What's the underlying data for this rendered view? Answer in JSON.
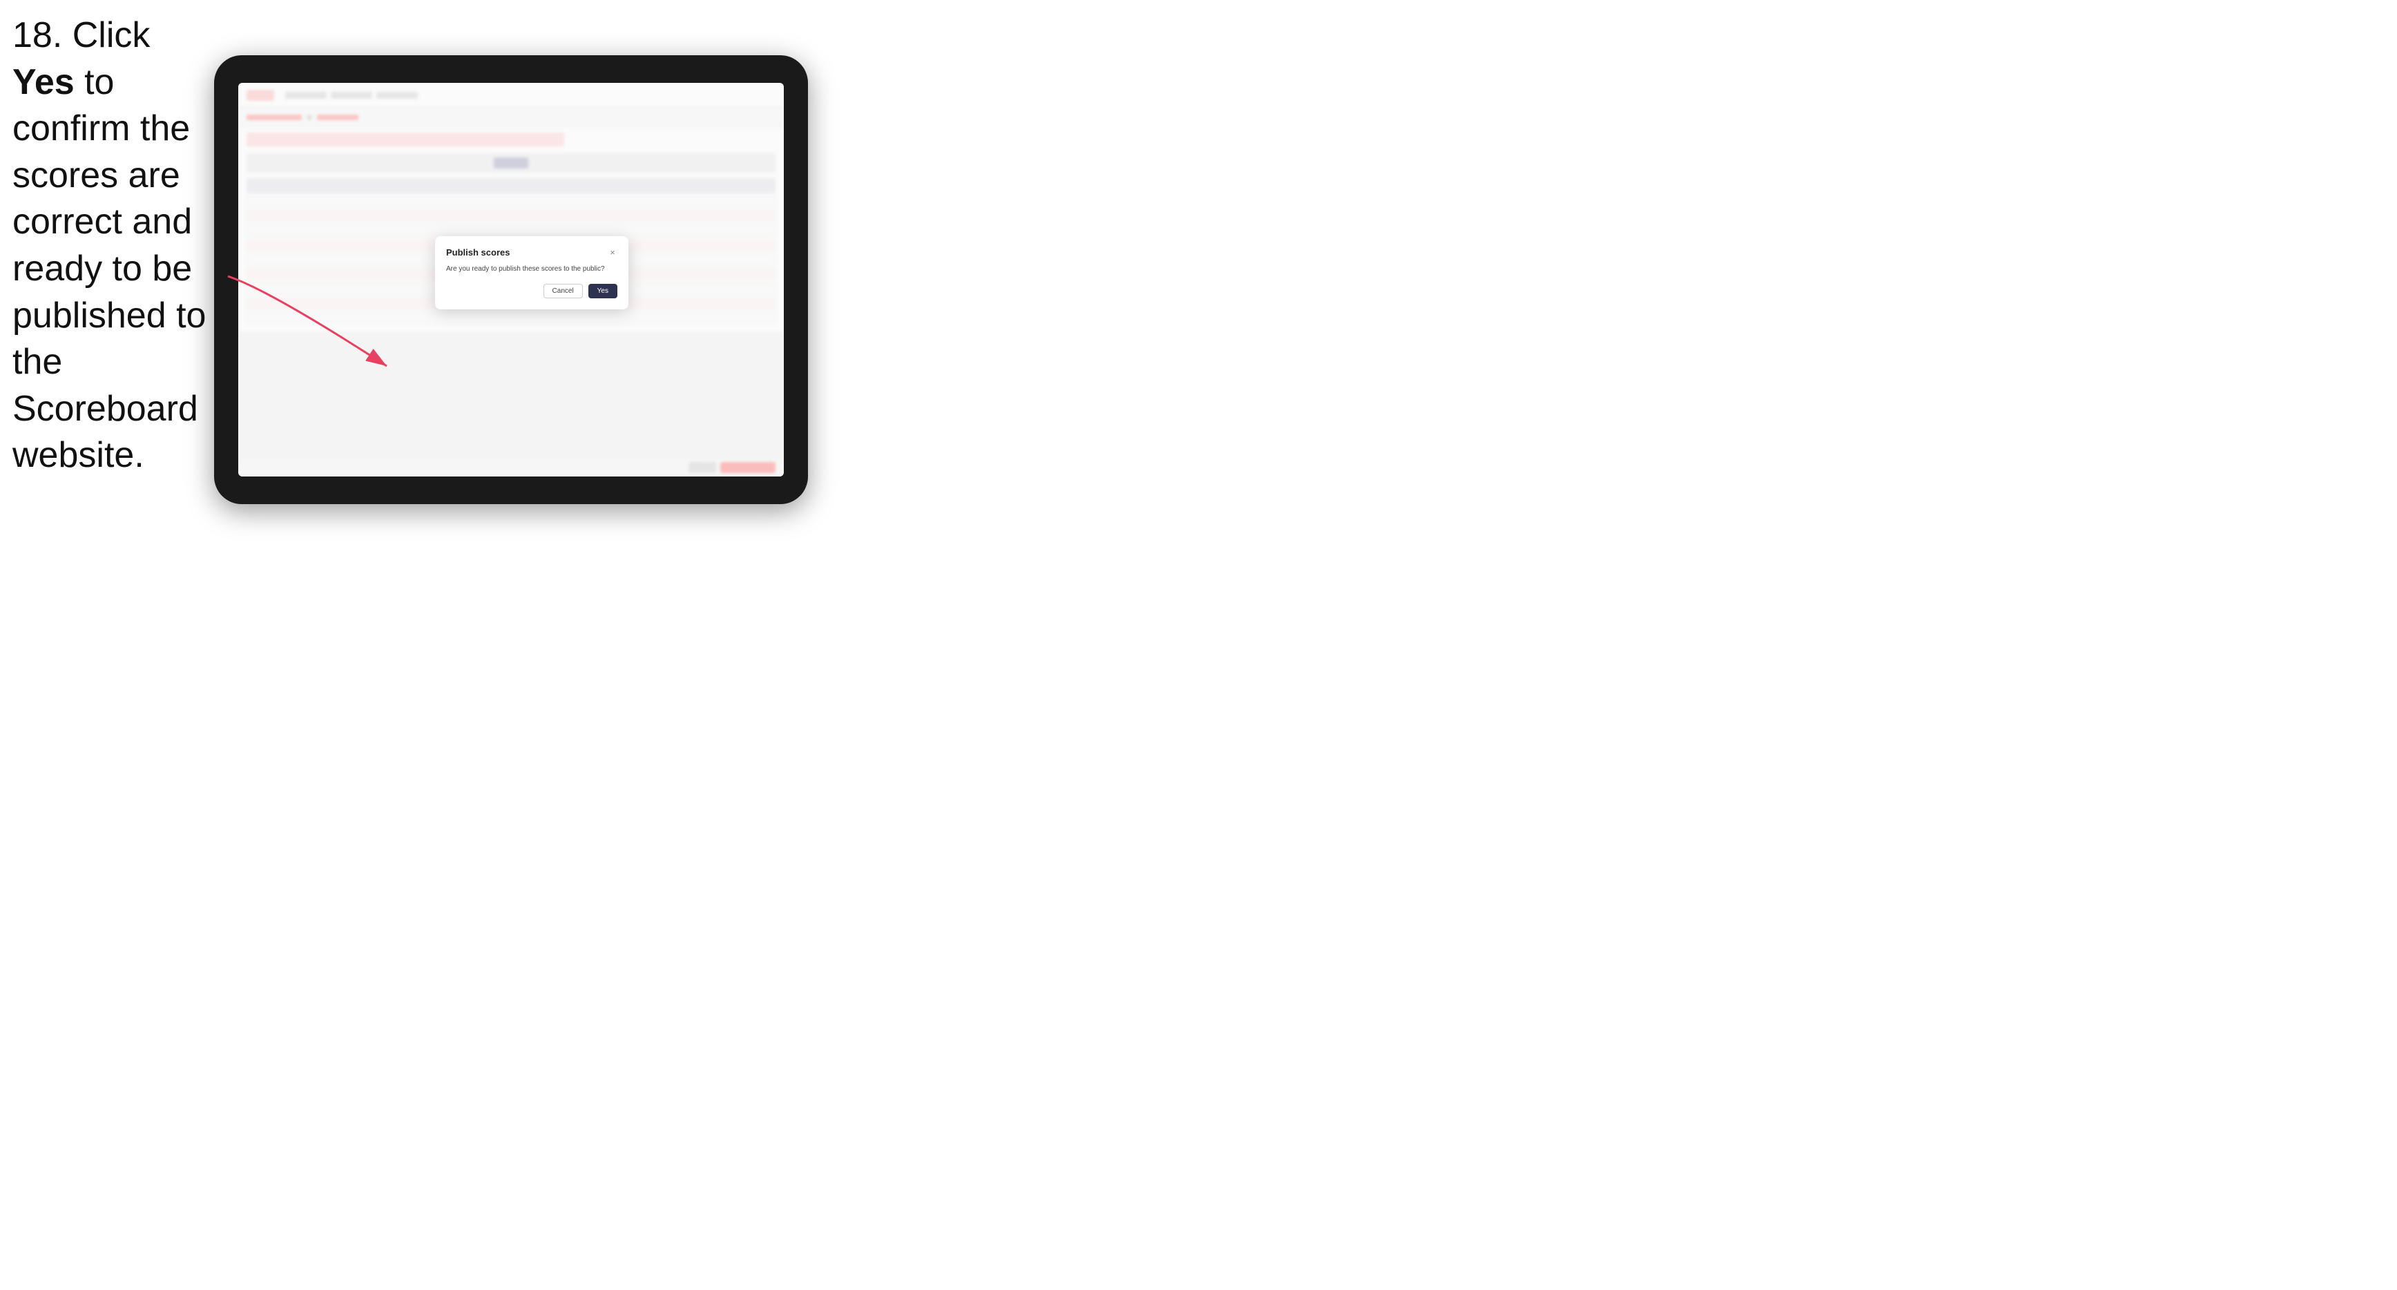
{
  "instruction": {
    "step_number": "18.",
    "text_part1": " Click ",
    "bold_word": "Yes",
    "text_part2": " to confirm the scores are correct and ready to be published to the Scoreboard website."
  },
  "dialog": {
    "title": "Publish scores",
    "message": "Are you ready to publish these scores to the public?",
    "cancel_label": "Cancel",
    "yes_label": "Yes",
    "close_icon": "×"
  },
  "colors": {
    "yes_button_bg": "#2d3250",
    "cancel_button_border": "#cccccc",
    "arrow_color": "#e84060"
  }
}
